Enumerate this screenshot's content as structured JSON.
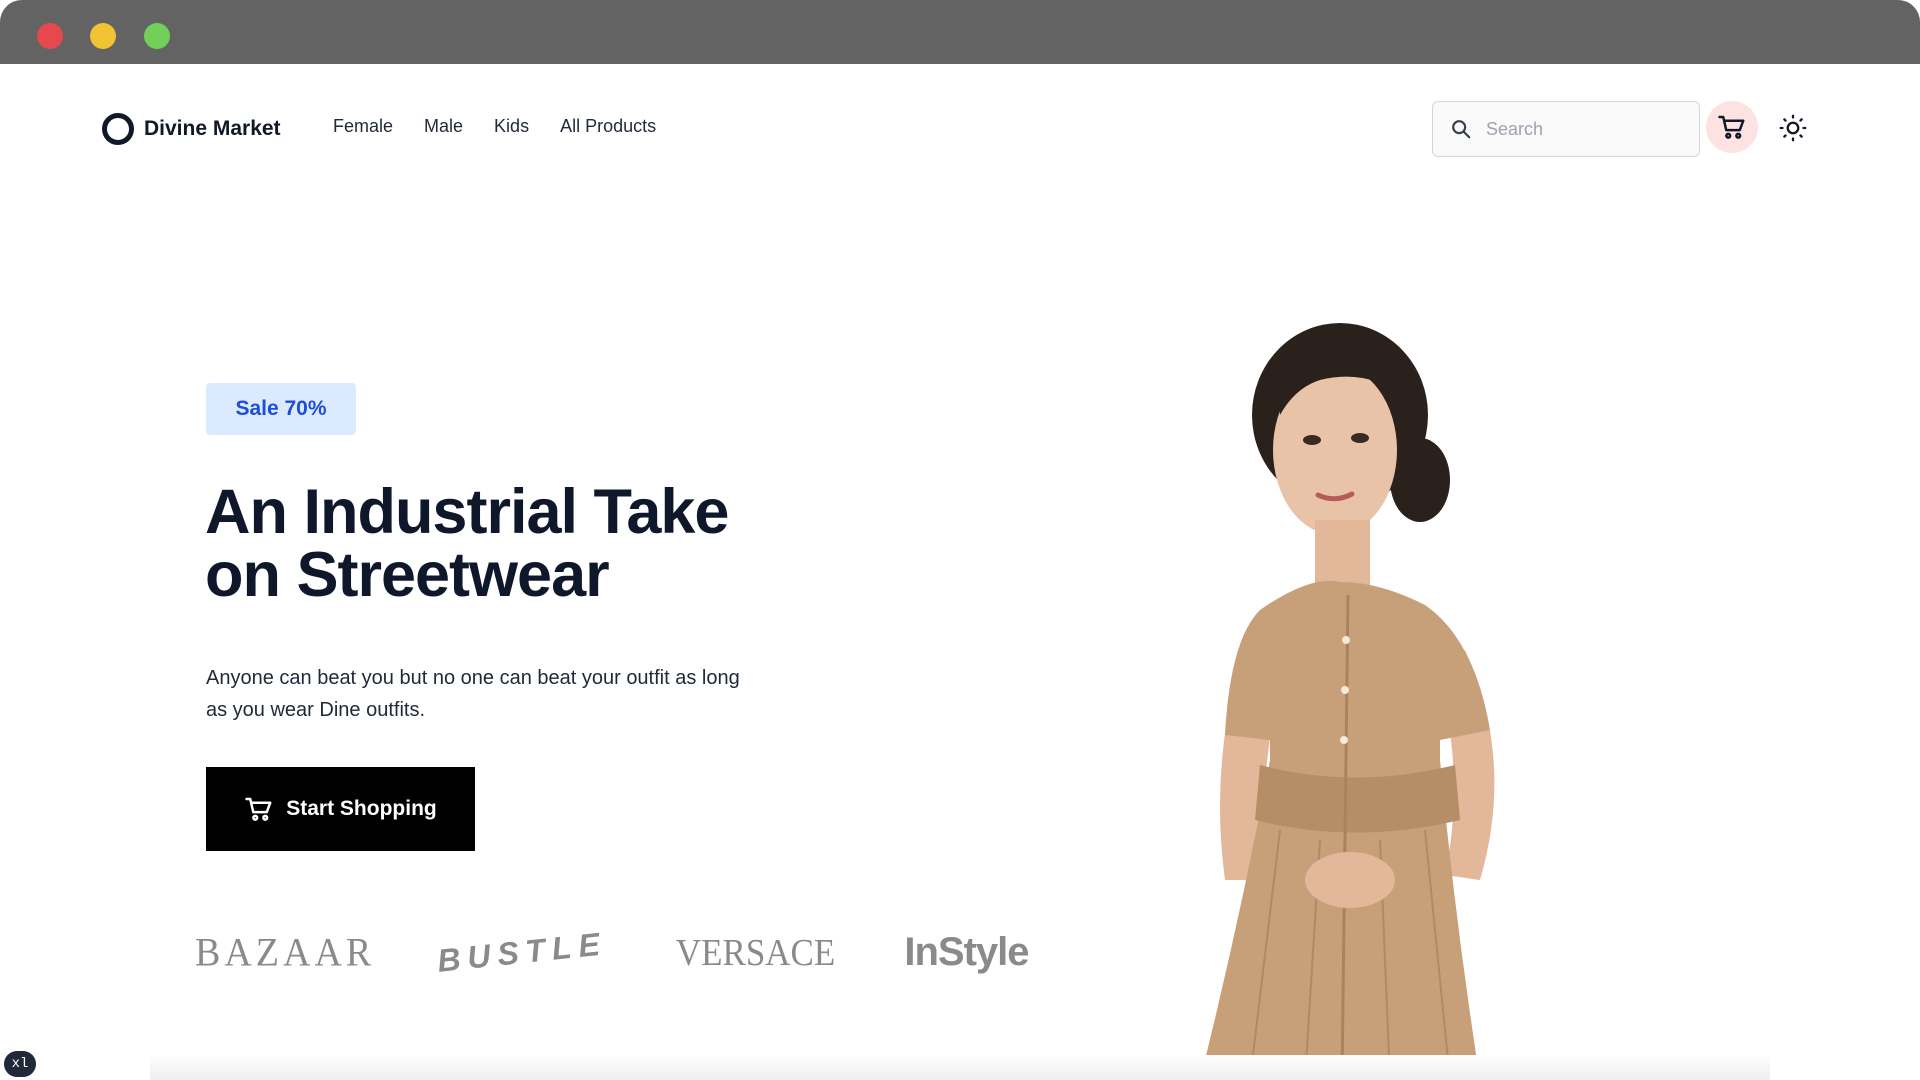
{
  "window": {
    "controls": [
      "close",
      "minimize",
      "maximize"
    ]
  },
  "nav": {
    "brand": "Divine Market",
    "links": [
      "Female",
      "Male",
      "Kids",
      "All Products"
    ],
    "search_placeholder": "Search",
    "icons": {
      "search": "search-icon",
      "cart": "cart-icon",
      "theme": "sun-icon"
    }
  },
  "hero": {
    "badge": "Sale 70%",
    "headline_line1": "An Industrial Take",
    "headline_line2": "on Streetwear",
    "subtext": "Anyone can beat you but no one can beat your outfit as long as you wear Dine outfits.",
    "cta_label": "Start Shopping"
  },
  "brands": [
    "BAZAAR",
    "BUSTLE",
    "VERSACE",
    "InStyle"
  ],
  "breakpoint_tag": "xl",
  "colors": {
    "badge_bg": "#dbeafe",
    "badge_text": "#1d4ed8",
    "cart_bg": "#fde2e2",
    "cta_bg": "#000000",
    "dress": "#c7a079"
  }
}
